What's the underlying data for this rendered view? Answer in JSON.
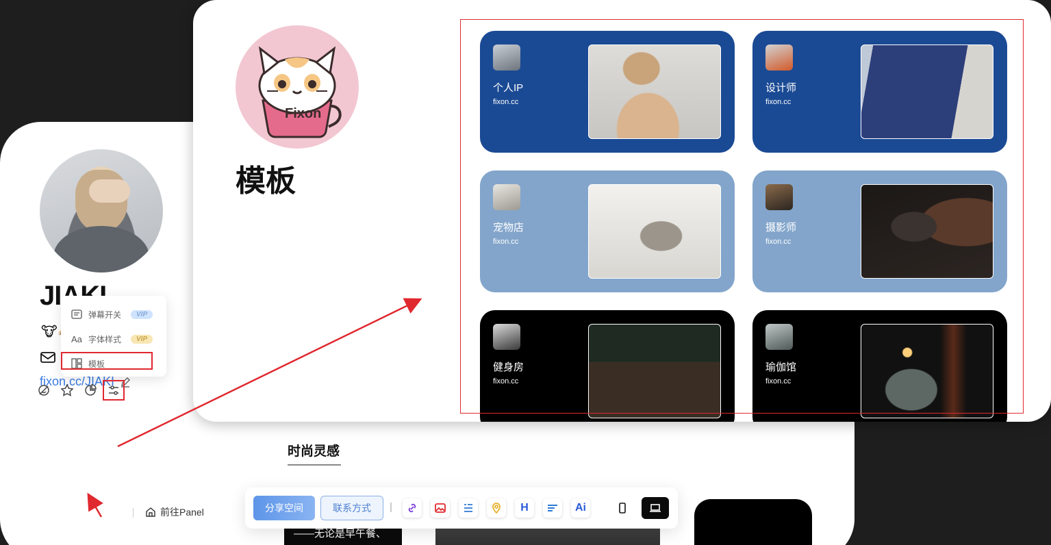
{
  "profile": {
    "name": "JIAKI",
    "emojis": "🐮🐴",
    "link": "fixon.cc/JIAKI"
  },
  "popup": {
    "items": [
      {
        "label": "弹幕开关",
        "badge": "VIP"
      },
      {
        "label": "字体样式",
        "badge": "VIP"
      },
      {
        "label": "模板",
        "badge": ""
      }
    ]
  },
  "bottom_tools": {
    "goto_label": "前往Panel"
  },
  "section": {
    "title": "时尚灵感",
    "snippet": "——无论是早午餐、"
  },
  "toolbar": {
    "share_label": "分享空间",
    "contact_label": "联系方式",
    "h_label": "H",
    "ai_label": "Ai"
  },
  "templates_page": {
    "logo_text": "Fixon",
    "title": "模板",
    "templates": [
      {
        "name": "个人IP",
        "url": "fixon.cc",
        "bg": "#1b4a94"
      },
      {
        "name": "设计师",
        "url": "fixon.cc",
        "bg": "#1b4a94"
      },
      {
        "name": "宠物店",
        "url": "fixon.cc",
        "bg": "#83a5cb"
      },
      {
        "name": "摄影师",
        "url": "fixon.cc",
        "bg": "#83a5cb"
      },
      {
        "name": "健身房",
        "url": "fixon.cc",
        "bg": "#000000"
      },
      {
        "name": "瑜伽馆",
        "url": "fixon.cc",
        "bg": "#000000"
      }
    ]
  },
  "colors": {
    "annotation_red": "#e0282f",
    "link_blue": "#3a7be3"
  }
}
